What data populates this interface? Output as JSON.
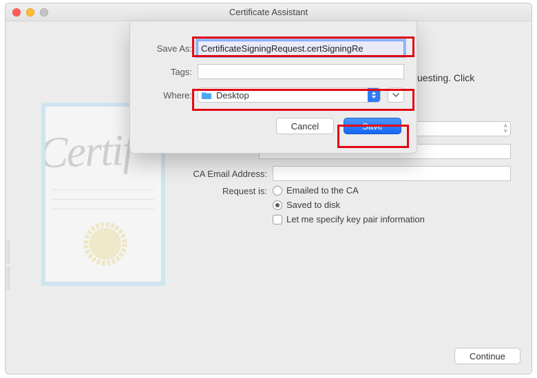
{
  "window": {
    "title": "Certificate Assistant"
  },
  "sheet": {
    "save_as_label": "Save As:",
    "save_as_value": "CertificateSigningRequest.certSigningRe",
    "tags_label": "Tags:",
    "tags_value": "",
    "where_label": "Where:",
    "where_value": "Desktop",
    "cancel_label": "Cancel",
    "save_label": "Save"
  },
  "hint_fragment": "uesting. Click",
  "form": {
    "ca_email_label": "CA Email Address:",
    "ca_email_value": "",
    "request_is_label": "Request is:",
    "option_email": "Emailed to the CA",
    "option_disk": "Saved to disk",
    "option_keypair": "Let me specify key pair information",
    "request_selected": "disk"
  },
  "footer": {
    "continue_label": "Continue"
  },
  "illustration": {
    "script_text": "Certif"
  }
}
